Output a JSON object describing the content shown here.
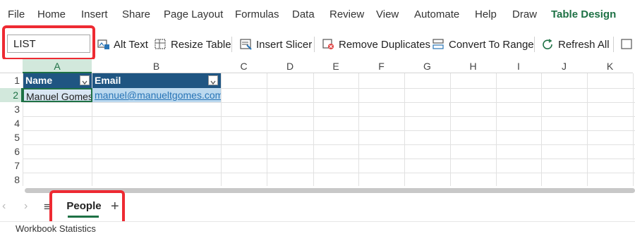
{
  "menu": {
    "items": [
      "File",
      "Home",
      "Insert",
      "Share",
      "Page Layout",
      "Formulas",
      "Data",
      "Review",
      "View",
      "Automate",
      "Help",
      "Draw",
      "Table Design"
    ],
    "active": "Table Design"
  },
  "ribbon": {
    "name_box": "LIST",
    "alt_text": "Alt Text",
    "resize_table": "Resize Table",
    "insert_slicer": "Insert Slicer",
    "remove_duplicates": "Remove Duplicates",
    "convert_to_range": "Convert To Range",
    "refresh_all": "Refresh All"
  },
  "grid": {
    "columns": [
      "A",
      "B",
      "C",
      "D",
      "E",
      "F",
      "G",
      "H",
      "I",
      "J",
      "K"
    ],
    "rows": [
      "1",
      "2",
      "3",
      "4",
      "5",
      "6",
      "7",
      "8"
    ],
    "table_headers": [
      "Name",
      "Email"
    ],
    "data_row": {
      "name": "Manuel Gomes",
      "email": "manuel@manueltgomes.com"
    }
  },
  "sheets": {
    "active": "People",
    "add_symbol": "+",
    "list_symbol": "≡",
    "prev_symbol": "‹",
    "next_symbol": "›"
  },
  "status": {
    "text": "Workbook Statistics"
  },
  "colors": {
    "accent": "#1e7145",
    "table_header": "#1f5582",
    "callout": "#ee2a32"
  }
}
